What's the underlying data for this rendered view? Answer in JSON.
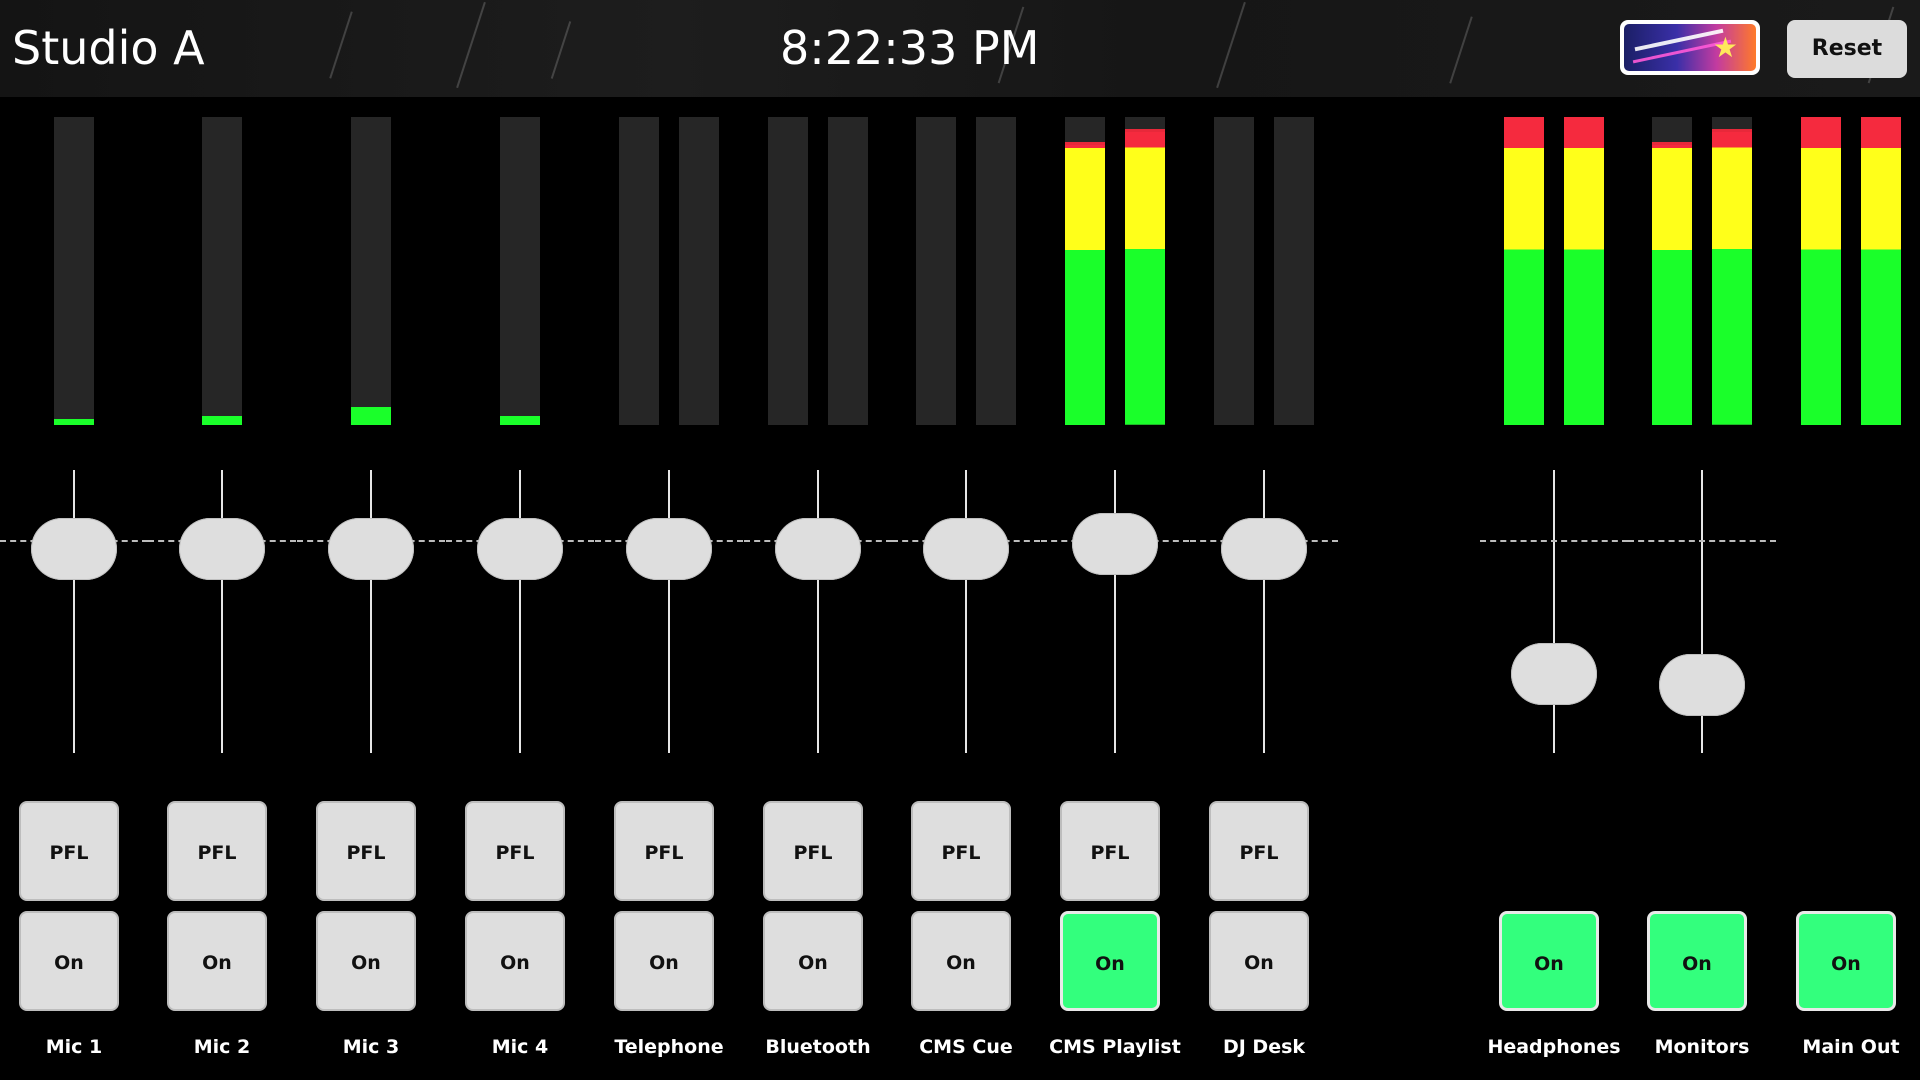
{
  "header": {
    "title": "Studio A",
    "clock": "8:22:33 PM",
    "reset_label": "Reset"
  },
  "colors": {
    "meter_green": "#1aff2a",
    "meter_yellow": "#ffff1a",
    "meter_red": "#f52a3e",
    "on_active": "#33ff7d",
    "button_gray": "#dedede"
  },
  "channels": [
    {
      "label": "Mic 1",
      "pfl": "PFL",
      "on": "On",
      "active": false,
      "meters": [
        0.02
      ],
      "fader": 0.72
    },
    {
      "label": "Mic 2",
      "pfl": "PFL",
      "on": "On",
      "active": false,
      "meters": [
        0.03
      ],
      "fader": 0.72
    },
    {
      "label": "Mic 3",
      "pfl": "PFL",
      "on": "On",
      "active": false,
      "meters": [
        0.06
      ],
      "fader": 0.72
    },
    {
      "label": "Mic 4",
      "pfl": "PFL",
      "on": "On",
      "active": false,
      "meters": [
        0.03
      ],
      "fader": 0.72
    },
    {
      "label": "Telephone",
      "pfl": "PFL",
      "on": "On",
      "active": false,
      "meters": [
        0,
        0
      ],
      "fader": 0.72
    },
    {
      "label": "Bluetooth",
      "pfl": "PFL",
      "on": "On",
      "active": false,
      "meters": [
        0,
        0
      ],
      "fader": 0.72
    },
    {
      "label": "CMS Cue",
      "pfl": "PFL",
      "on": "On",
      "active": false,
      "meters": [
        0,
        0
      ],
      "fader": 0.72
    },
    {
      "label": "CMS Playlist",
      "pfl": "PFL",
      "on": "On",
      "active": true,
      "meters": [
        0.92,
        0.96
      ],
      "fader": 0.74
    },
    {
      "label": "DJ Desk",
      "pfl": "PFL",
      "on": "On",
      "active": false,
      "meters": [
        0,
        0
      ],
      "fader": 0.72
    }
  ],
  "outputs": [
    {
      "label": "Headphones",
      "on": "On",
      "active": true,
      "meters": [
        1.0,
        1.0
      ],
      "fader": 0.28
    },
    {
      "label": "Monitors",
      "on": "On",
      "active": true,
      "meters": [
        0.92,
        0.96
      ],
      "fader": 0.24
    },
    {
      "label": "Main Out",
      "on": "On",
      "active": true,
      "meters": [
        1.0,
        1.0
      ],
      "fader": null
    }
  ]
}
